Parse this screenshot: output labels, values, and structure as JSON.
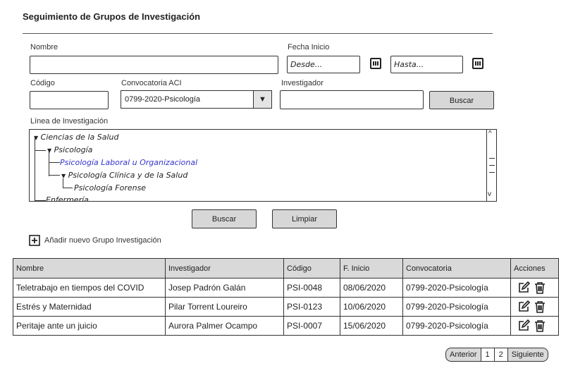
{
  "page": {
    "title": "Seguimiento de Grupos de Investigación"
  },
  "form": {
    "nombre_label": "Nombre",
    "nombre_value": "",
    "fecha_label": "Fecha Inicio",
    "desde_placeholder": "Desde...",
    "hasta_placeholder": "Hasta...",
    "codigo_label": "Código",
    "codigo_value": "",
    "convocatoria_label": "Convocatoria ACI",
    "convocatoria_value": "0799-2020-Psicología",
    "investigador_label": "Investigador",
    "investigador_value": "",
    "buscar_inline_label": "Buscar",
    "linea_label": "Línea de Investigación"
  },
  "tree": {
    "nodes": [
      {
        "label": "Ciencias de la Salud",
        "marker": "▼",
        "selected": false
      },
      {
        "label": "Psicología",
        "marker": "▼",
        "selected": false
      },
      {
        "label": "Psicología Laboral u Organizacional",
        "marker": "",
        "selected": true
      },
      {
        "label": "Psicología Clínica y de la Salud",
        "marker": "▼",
        "selected": false
      },
      {
        "label": "Psicología Forense",
        "marker": "",
        "selected": false
      },
      {
        "label": "Enfermería",
        "marker": "",
        "selected": false
      }
    ],
    "selected_color": "#3333cc"
  },
  "actions": {
    "buscar_label": "Buscar",
    "limpiar_label": "Limpiar",
    "add_label": "Añadir nuevo Grupo Investigación"
  },
  "table": {
    "headers": [
      "Nombre",
      "Investigador",
      "Código",
      "F. Inicio",
      "Convocatoria",
      "Acciones"
    ],
    "rows": [
      [
        "Teletrabajo en tiempos del COVID",
        "Josep Padrón Galán",
        "PSI-0048",
        "08/06/2020",
        "0799-2020-Psicología"
      ],
      [
        "Estrés y Maternidad",
        "Pilar Torrent Loureiro",
        "PSI-0123",
        "10/06/2020",
        "0799-2020-Psicología"
      ],
      [
        "Peritaje ante un juicio",
        "Aurora Palmer Ocampo",
        "PSI-0007",
        "15/06/2020",
        "0799-2020-Psicología"
      ]
    ],
    "row_icons": [
      "edit-icon",
      "trash-icon"
    ]
  },
  "pager": {
    "prev": "Anterior",
    "pages": [
      "1",
      "2"
    ],
    "next": "Siguiente"
  }
}
